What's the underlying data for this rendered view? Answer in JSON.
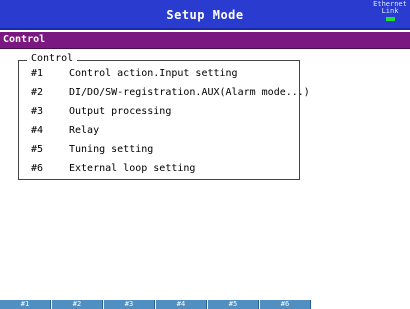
{
  "header": {
    "title": "Setup Mode",
    "ethernet_label": "Ethernet",
    "link_label": "Link",
    "link_led_color": "#22dd33"
  },
  "section": {
    "title": "Control"
  },
  "menu": {
    "legend": "Control",
    "items": [
      {
        "num": "#1",
        "label": "Control action.Input setting"
      },
      {
        "num": "#2",
        "label": "DI/DO/SW-registration.AUX(Alarm mode...)"
      },
      {
        "num": "#3",
        "label": "Output processing"
      },
      {
        "num": "#4",
        "label": "Relay"
      },
      {
        "num": "#5",
        "label": "Tuning setting"
      },
      {
        "num": "#6",
        "label": "External loop setting"
      }
    ]
  },
  "softkeys": [
    "#1",
    "#2",
    "#3",
    "#4",
    "#5",
    "#6"
  ],
  "colors": {
    "title_bar": "#2a3ccf",
    "section_bar": "#7a1780",
    "softkey": "#4f8fc2"
  }
}
